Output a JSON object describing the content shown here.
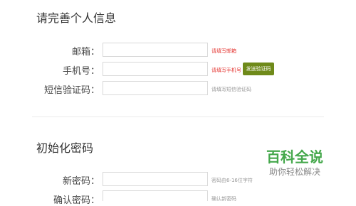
{
  "profile_section": {
    "title": "请完善个人信息",
    "fields": [
      {
        "label": "邮箱：",
        "hint": "请填写邮箱"
      },
      {
        "label": "手机号：",
        "hint": "请填写手机号"
      },
      {
        "label": "短信验证码：",
        "hint": "请填写短信验证码"
      }
    ],
    "send_code_label": "发送验证码"
  },
  "password_section": {
    "title": "初始化密码",
    "fields": [
      {
        "label": "新密码：",
        "hint": "密码由6-16位字符"
      },
      {
        "label": "确认密码：",
        "hint": "确认新密码"
      }
    ]
  },
  "watermark": {
    "logo": "百科全说",
    "slogan": "助你轻松解决"
  },
  "colors": {
    "error_hint": "#e53935",
    "button_bg": "#6f8a1a",
    "watermark_green": "#45a84c"
  }
}
